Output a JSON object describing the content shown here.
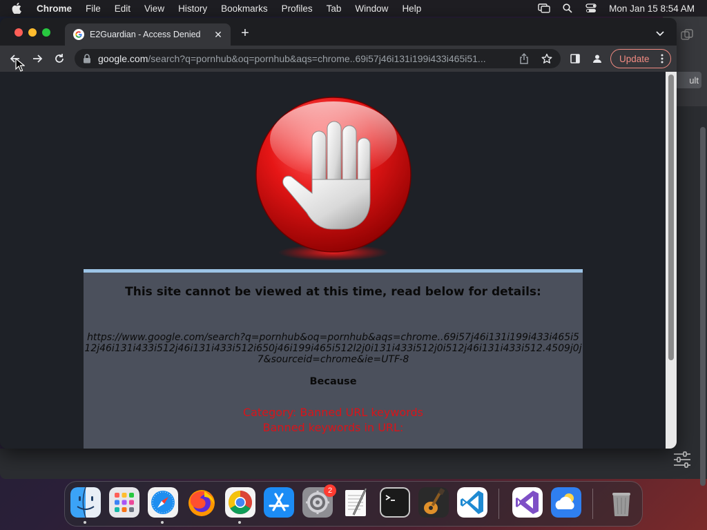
{
  "menubar": {
    "app_name": "Chrome",
    "items": [
      "File",
      "Edit",
      "View",
      "History",
      "Bookmarks",
      "Profiles",
      "Tab",
      "Window",
      "Help"
    ],
    "clock": "Mon Jan 15  8:54 AM"
  },
  "background_window": {
    "button_label": "ult"
  },
  "browser": {
    "tab": {
      "title": "E2Guardian - Access Denied",
      "close_symbol": "✕"
    },
    "new_tab_symbol": "+",
    "omnibox": {
      "domain": "google.com",
      "path": "/search?q=pornhub&oq=pornhub&aqs=chrome..69i57j46i131i199i433i465i51..."
    },
    "update_label": "Update"
  },
  "page": {
    "heading": "This site cannot be viewed at this time, read below for details:",
    "blocked_url": "https://www.google.com/search?q=pornhub&oq=pornhub&aqs=chrome..69i57j46i131i199i433i465i512j46i131i433i512j46i131i433i512i650j46i199i465i512l2j0i131i433i512j0i512j46i131i433i512.4509j0j7&sourceid=chrome&ie=UTF-8",
    "because_label": "Because",
    "category": "Category: Banned URL keywords",
    "reason": "Banned keywords in URL:"
  },
  "dock": {
    "apps": [
      "Finder",
      "Launchpad",
      "Safari",
      "Firefox",
      "Google Chrome",
      "App Store",
      "System Settings",
      "TextEdit",
      "Terminal",
      "GarageBand",
      "Visual Studio Code",
      "Visual Studio",
      "Weather",
      "Trash"
    ],
    "settings_badge": "2"
  },
  "colors": {
    "accent_update": "#f28b82",
    "banned_text": "#d8141a",
    "panel_bg": "#4b505c",
    "panel_border": "#9cc4e6"
  }
}
